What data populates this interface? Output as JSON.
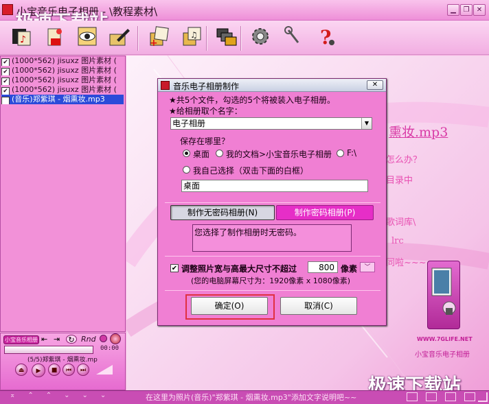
{
  "window": {
    "title": "小宝音乐电子相册 - \\教程素材\\",
    "watermark": "极速下载站",
    "controls": [
      "minimize",
      "restore",
      "close"
    ]
  },
  "toolbar": {
    "buttons": [
      "new-album-icon",
      "open-icon",
      "preview-icon",
      "edit-icon",
      "add-photo-icon",
      "add-music-icon",
      "export-icon",
      "settings-icon",
      "tools-icon",
      "help-icon"
    ]
  },
  "filelist": {
    "items": [
      {
        "text": "(1000*562) jisuxz 图片素材 (",
        "checked": true,
        "selected": false
      },
      {
        "text": "(1000*562) jisuxz 图片素材 (",
        "checked": true,
        "selected": false
      },
      {
        "text": "(1000*562) jisuxz 图片素材 (",
        "checked": true,
        "selected": false
      },
      {
        "text": "(1000*562) jisuxz 图片素材 (",
        "checked": true,
        "selected": false
      },
      {
        "text": "(音乐)郑紫琪 - 烟熏妆.mp3",
        "checked": true,
        "selected": true
      }
    ]
  },
  "player": {
    "logo": "小宝音乐相册",
    "track": "(5/5)郑紫琪 - 烟熏妆.mp",
    "time": "00:00",
    "rnd": "Rnd"
  },
  "main": {
    "song": "熏妆.mp3",
    "line1": "怎么办？",
    "line2": "目录中",
    "line3": "歌词库\\",
    "line4": "lrc",
    "line5": "同啦~~~",
    "site": "WWW.7GLIFE.NET",
    "brand": "小宝音乐电子相册"
  },
  "dialog": {
    "title": "音乐电子相册制作",
    "info": "★共5个文件，勾选的5个将被装入电子相册。",
    "name_label": "★给相册取个名字：",
    "name_value": "电子相册",
    "save_label": "保存在哪里？",
    "opt_desktop": "桌面",
    "opt_mydocs": "我的文档>小宝音乐电子相册",
    "opt_f": "F:\\",
    "opt_custom": "我自己选择（双击下面的白框）",
    "path_value": "桌面",
    "tab_nopwd": "制作无密码相册(N)",
    "tab_pwd": "制作密码相册(P)",
    "desc": "您选择了制作相册时无密码。",
    "resize_label": "调整照片宽与高最大尺寸不超过",
    "resize_value": "800",
    "resize_unit": "像素",
    "screen_info": "(您的电脑屏幕尺寸为：1920像素 x 1080像素)",
    "ok": "确定(O)",
    "cancel": "取消(C)"
  },
  "status": {
    "text": "在这里为照片(音乐)\"郑紫琪 - 烟熏妆.mp3\"添加文字说明吧~~"
  }
}
